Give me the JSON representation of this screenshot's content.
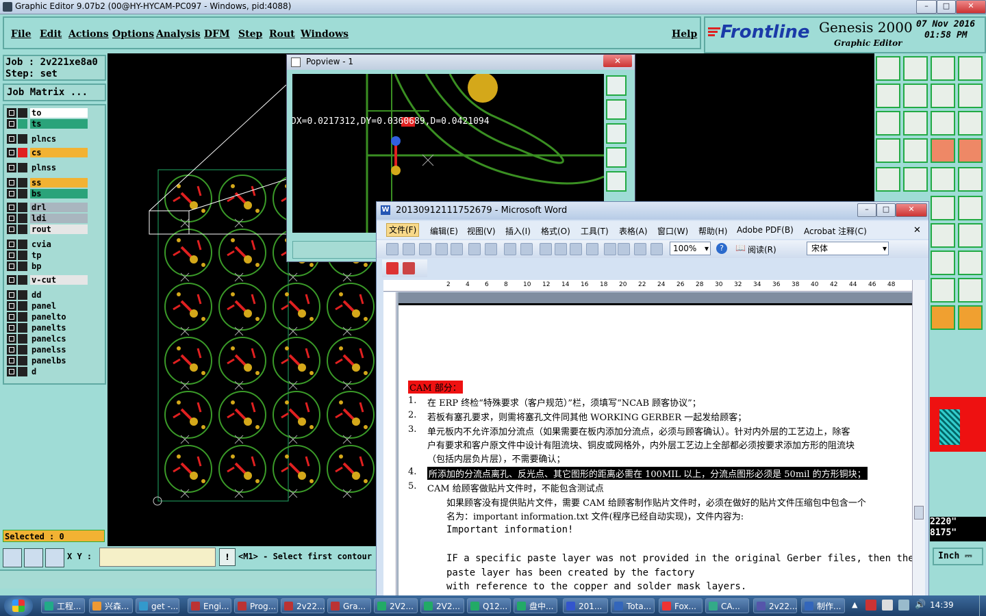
{
  "window_title": "Graphic Editor 9.07b2 (00@HY-HYCAM-PC097 - Windows, pid:4088)",
  "menu": [
    "File",
    "Edit",
    "Actions",
    "Options",
    "Analysis",
    "DFM",
    "Step",
    "Rout",
    "Windows"
  ],
  "help": "Help",
  "brand": {
    "logo": "Frontline",
    "product": "Genesis 2000",
    "subtitle": "Graphic Editor",
    "date": "07 Nov 2016",
    "time": "01:58 PM"
  },
  "job": {
    "job_label": "Job : 2v221xe8a0",
    "step_label": "Step: set",
    "matrix_button": "Job Matrix ..."
  },
  "layers": [
    {
      "name": "to",
      "color": "#ffffff",
      "swatch": "#222222"
    },
    {
      "name": "ts",
      "color": "#2aa37a",
      "swatch": "#2aa37a"
    },
    {
      "name": "plncs",
      "color": "#a6dbd4",
      "swatch": "#222222"
    },
    {
      "name": "cs",
      "color": "#f2b233",
      "swatch": "#e02020"
    },
    {
      "name": "plnss",
      "color": "#a6dbd4",
      "swatch": "#222222"
    },
    {
      "name": "ss",
      "color": "#f2b233",
      "swatch": "#222222"
    },
    {
      "name": "bs",
      "color": "#2aa37a",
      "swatch": "#222222"
    },
    {
      "name": "drl",
      "color": "#a9b6bf",
      "swatch": "#222222"
    },
    {
      "name": "ldi",
      "color": "#a9b6bf",
      "swatch": "#222222"
    },
    {
      "name": "rout",
      "color": "#e6e6e6",
      "swatch": "#222222"
    },
    {
      "name": "cvia",
      "color": "#a6dbd4",
      "swatch": "#222222"
    },
    {
      "name": "tp",
      "color": "#a6dbd4",
      "swatch": "#222222"
    },
    {
      "name": "bp",
      "color": "#a6dbd4",
      "swatch": "#222222"
    },
    {
      "name": "v-cut",
      "color": "#e6e6e6",
      "swatch": "#222222"
    },
    {
      "name": "dd",
      "color": "#a6dbd4",
      "swatch": "#222222"
    },
    {
      "name": "panel",
      "color": "#a6dbd4",
      "swatch": "#222222"
    },
    {
      "name": "panelto",
      "color": "#a6dbd4",
      "swatch": "#222222"
    },
    {
      "name": "panelts",
      "color": "#a6dbd4",
      "swatch": "#222222"
    },
    {
      "name": "panelcs",
      "color": "#a6dbd4",
      "swatch": "#222222"
    },
    {
      "name": "panelss",
      "color": "#a6dbd4",
      "swatch": "#222222"
    },
    {
      "name": "panelbs",
      "color": "#a6dbd4",
      "swatch": "#222222"
    },
    {
      "name": "d",
      "color": "#a6dbd4",
      "swatch": "#222222"
    }
  ],
  "status": {
    "selected": "Selected : 0",
    "xy_label": "X Y :",
    "prompt": "<M1> - Select first contour",
    "units": "Inch",
    "coord1": "2220\"",
    "coord2": "8175\""
  },
  "popview": {
    "title": "Popview - 1",
    "measure": "DX=0.0217312,DY=0.0360689,D=0.0421094"
  },
  "word": {
    "title": "20130912111752679 - Microsoft Word",
    "menu": [
      "文件(F)",
      "编辑(E)",
      "视图(V)",
      "插入(I)",
      "格式(O)",
      "工具(T)",
      "表格(A)",
      "窗口(W)",
      "帮助(H)",
      "Adobe PDF(B)",
      "Acrobat 注释(C)"
    ],
    "zoom": "100%",
    "reading": "阅读(R)",
    "font": "宋体",
    "ruler": [
      "2",
      "4",
      "6",
      "8",
      "10",
      "12",
      "14",
      "16",
      "18",
      "20",
      "22",
      "24",
      "26",
      "28",
      "30",
      "32",
      "34",
      "36",
      "38",
      "40",
      "42",
      "44",
      "46",
      "48"
    ],
    "heading": "CAM 部分：",
    "items": [
      {
        "num": "1.",
        "text": "在 ERP 终检“特殊要求（客户规范）”栏，须填写“NCAB 顾客协议”；"
      },
      {
        "num": "2.",
        "text": "若板有塞孔要求，则需将塞孔文件同其他 WORKING GERBER 一起发给顾客；"
      },
      {
        "num": "3.",
        "text": "单元板内不允许添加分流点（如果需要在板内添加分流点，必须与顾客确认）。针对内外层的工艺边上，除客"
      },
      {
        "num": "",
        "text": "户有要求和客户原文件中设计有阻流块、铜皮或网格外，内外层工艺边上全部都必须按要求添加方形的阻流块"
      },
      {
        "num": "",
        "text": "（包括内层负片层），不需要确认；"
      },
      {
        "num": "4.",
        "text": "所添加的分流点离孔、反光点、其它图形的距离必需在 100MIL 以上，分流点图形必须是 50mil 的方形铜块；"
      },
      {
        "num": "5.",
        "text": "CAM 给顾客做贴片文件时，不能包含测试点"
      }
    ],
    "sub": [
      "如果顾客没有提供贴片文件，需要 CAM 给顾客制作贴片文件时，必须在做好的贴片文件压缩包中包含一个",
      "名为：important information.txt 文件(程序已经自动实现)，文件内容为:",
      "Important information!",
      "IF a specific paste layer was not provided in the original Gerber files, then the",
      "paste layer has been created by the factory",
      "with reference to the copper and solder mask layers."
    ]
  },
  "taskbar": {
    "items": [
      "工程...",
      "兴森...",
      "get -...",
      "Engi...",
      "Prog...",
      "2v22...",
      "Gra...",
      "2V2...",
      "2V2...",
      "Q12...",
      "盘中...",
      "201...",
      "Tota...",
      "Fox...",
      "CA...",
      "2v22...",
      "制作..."
    ],
    "clock": "14:39"
  }
}
